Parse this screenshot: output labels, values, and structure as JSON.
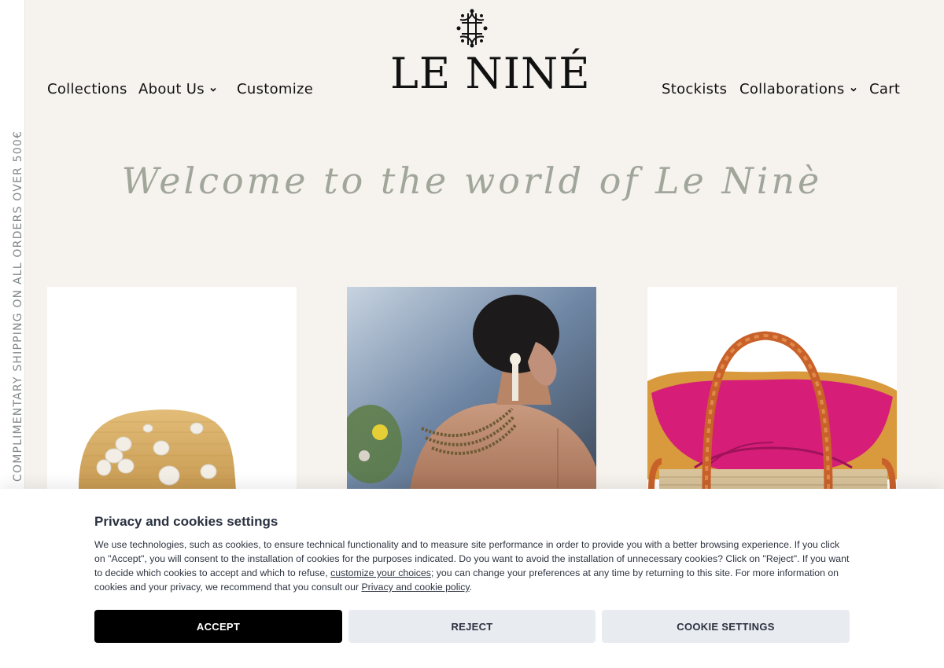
{
  "side_banner": {
    "text": "COMPLIMENTARY SHIPPING ON ALL ORDERS OVER 500€"
  },
  "brand": {
    "name": "LE NINÉ",
    "logo_icon": "monogram-icon"
  },
  "nav": {
    "left": [
      {
        "label": "Collections",
        "has_dropdown": false
      },
      {
        "label": "About Us",
        "has_dropdown": true
      },
      {
        "label": "Customize",
        "has_dropdown": false
      }
    ],
    "right": [
      {
        "label": "Stockists",
        "has_dropdown": false
      },
      {
        "label": "Collaborations",
        "has_dropdown": true
      },
      {
        "label": "Cart",
        "has_dropdown": false
      }
    ]
  },
  "hero": {
    "heading": "Welcome to the world of Le Ninè"
  },
  "products": [
    {
      "name": "straw-hat-with-sequin-flowers"
    },
    {
      "name": "woman-with-beaded-necklace"
    },
    {
      "name": "straw-basket-bag-pink-lining"
    }
  ],
  "cookie_banner": {
    "title": "Privacy and cookies settings",
    "text_1": "We use technologies, such as cookies, to ensure technical functionality and to measure site performance in order to provide you with a better browsing experience. If you click on \"Accept\", you will consent to the installation of cookies for the purposes indicated. Do you want to avoid the installation of unnecessary cookies? Click on \"Reject\". If you want to decide which cookies to accept and which to refuse, ",
    "link_1": "customize your choices",
    "text_2": "; you can change your preferences at any time by returning to this site. For more information on cookies and your privacy, we recommend that you consult our ",
    "link_2": "Privacy and cookie policy",
    "text_3": ".",
    "accept_label": "ACCEPT",
    "reject_label": "REJECT",
    "settings_label": "COOKIE SETTINGS"
  },
  "colors": {
    "background": "#f6f3ef",
    "heading_script": "#a1a69a",
    "accept_button": "#000000",
    "secondary_button": "#e8ebef"
  }
}
